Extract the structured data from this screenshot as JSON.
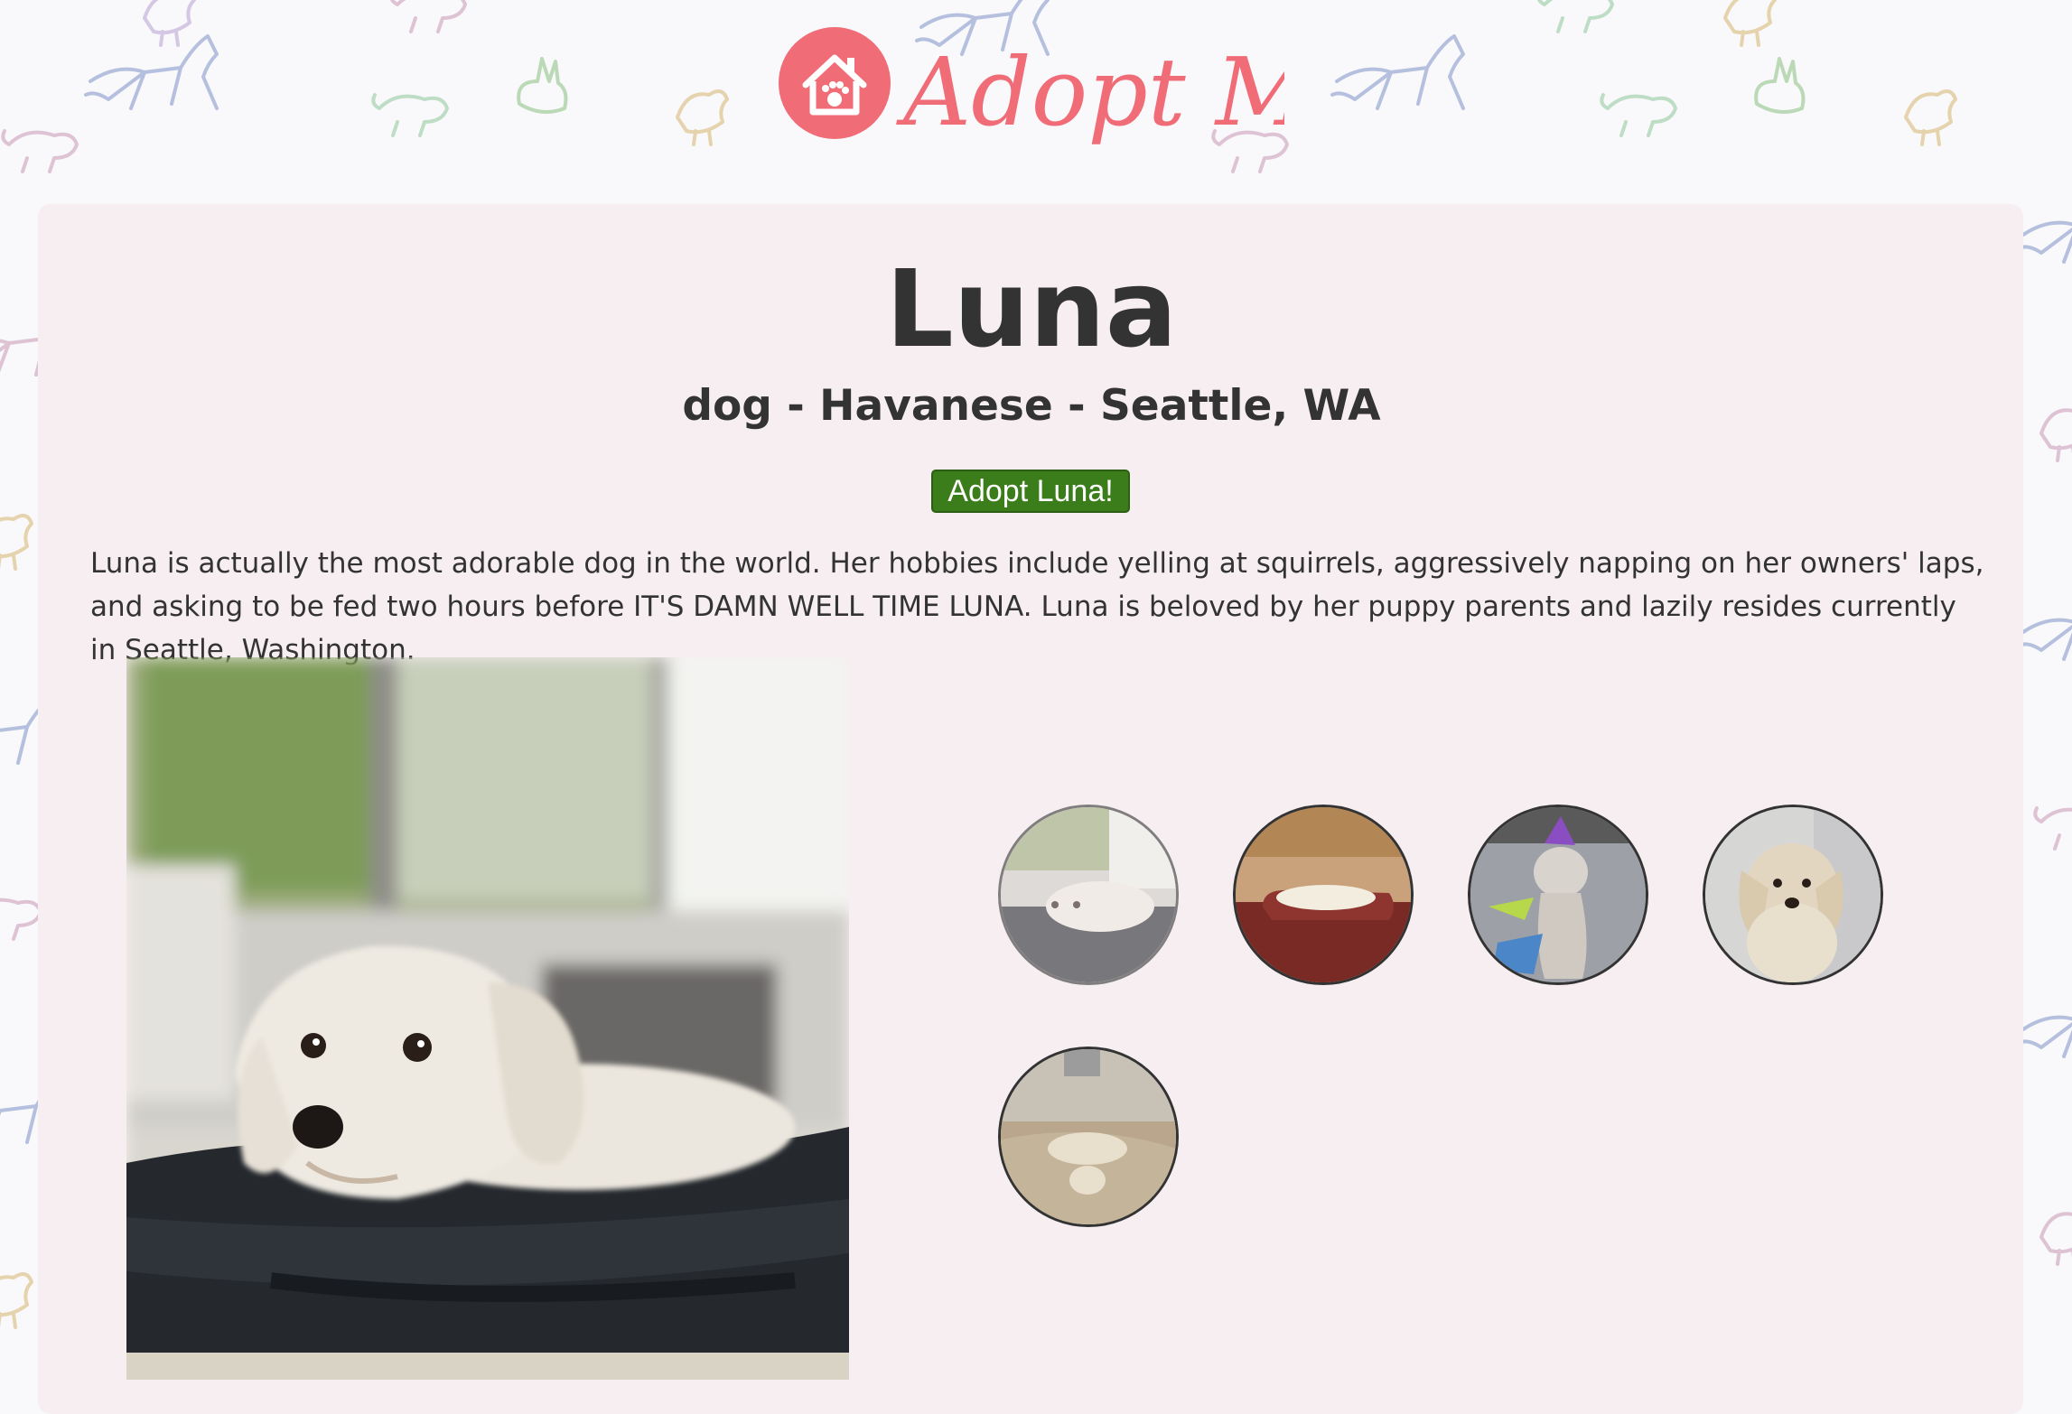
{
  "site": {
    "logo_text": "Adopt Me!",
    "brand_color": "#f06d78"
  },
  "pet": {
    "name": "Luna",
    "subtitle": "dog - Havanese - Seattle, WA",
    "adopt_button_label": "Adopt Luna!",
    "description": "Luna is actually the most adorable dog in the world. Her hobbies include yelling at squirrels, aggressively napping on her owners' laps, and asking to be fed two hours before IT'S DAMN WELL TIME LUNA. Luna is beloved by her puppy parents and lazily resides currently in Seattle, Washington."
  },
  "carousel": {
    "active_index": 0,
    "thumbnails": [
      {
        "icon": "dog-in-suitcase-photo"
      },
      {
        "icon": "dog-on-couch-photo"
      },
      {
        "icon": "dog-party-hat-photo"
      },
      {
        "icon": "dog-portrait-photo"
      },
      {
        "icon": "dog-on-rug-photo"
      }
    ]
  },
  "colors": {
    "button_green": "#3a7d1a",
    "card_background": "#f6eef0",
    "text": "#333333"
  }
}
